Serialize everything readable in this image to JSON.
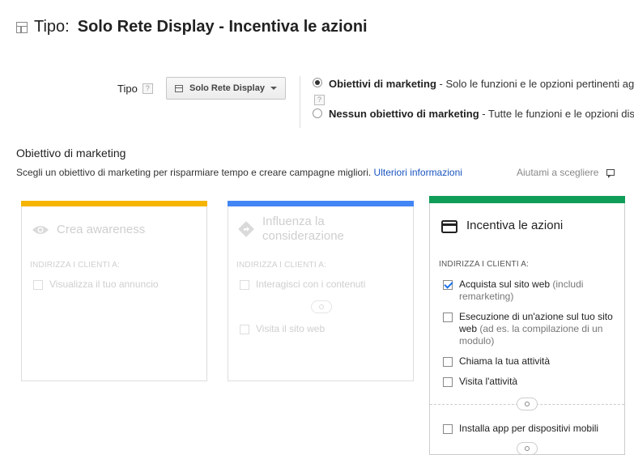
{
  "header": {
    "prefix": "Tipo:",
    "title": "Solo Rete Display - Incentiva le azioni"
  },
  "type_selector": {
    "label": "Tipo",
    "help": "?",
    "button_label": "Solo Rete Display"
  },
  "options": [
    {
      "title": "Obiettivi di marketing",
      "desc": " - Solo le funzioni e le opzioni pertinenti ag",
      "selected": true,
      "help": "?"
    },
    {
      "title": "Nessun obiettivo di marketing",
      "desc": " - Tutte le funzioni e le opzioni dis",
      "selected": false
    }
  ],
  "section": {
    "title": "Obiettivo di marketing",
    "description": "Scegli un obiettivo di marketing per risparmiare tempo e creare campagne migliori.",
    "link": "Ulteriori informazioni",
    "help_link": "Aiutami a scegliere"
  },
  "cards": [
    {
      "title": "Crea awareness",
      "sub": "INDIRIZZA I CLIENTI A:",
      "items": [
        {
          "label": "Visualizza il tuo annuncio",
          "checked": false
        }
      ],
      "color": "#f4b400",
      "icon": "eye-icon"
    },
    {
      "title": "Influenza la considerazione",
      "sub": "INDIRIZZA I CLIENTI A:",
      "items": [
        {
          "label": "Interagisci con i contenuti",
          "checked": false
        },
        {
          "label": "Visita il sito web",
          "checked": false
        }
      ],
      "color": "#4285f4",
      "icon": "diamond-arrow-icon"
    },
    {
      "title": "Incentiva le azioni",
      "sub": "INDIRIZZA I CLIENTI A:",
      "items": [
        {
          "label": "Acquista sul sito web",
          "note": " (includi remarketing)",
          "checked": true
        },
        {
          "label": "Esecuzione di un'azione sul tuo sito web",
          "note": " (ad es. la compilazione di un modulo)",
          "checked": false
        },
        {
          "label": "Chiama la tua attività",
          "checked": false
        },
        {
          "label": "Visita l'attività",
          "checked": false
        },
        {
          "label": "Installa app per dispositivi mobili",
          "checked": false
        }
      ],
      "color": "#0f9d58",
      "icon": "card-icon"
    }
  ]
}
